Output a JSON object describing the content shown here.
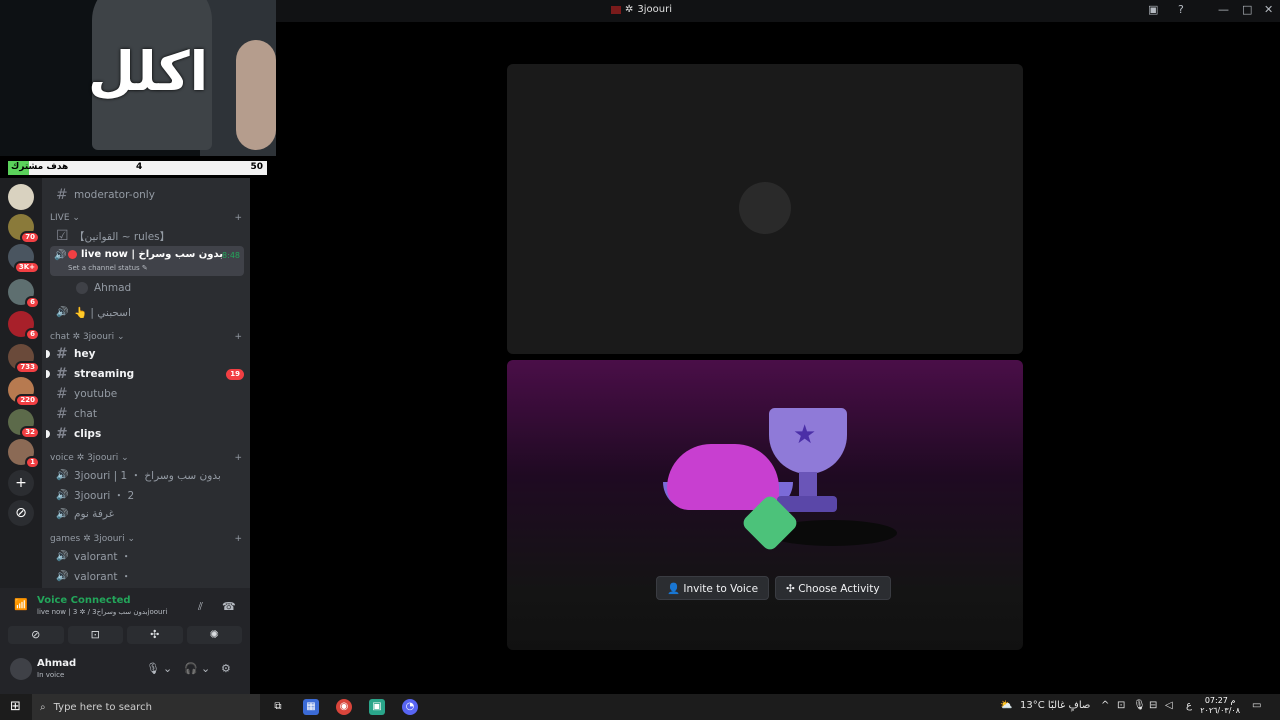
{
  "window": {
    "title": "3joouri",
    "title_prefix": "✲"
  },
  "webcam": {
    "overlay_text": "اكلل"
  },
  "goal": {
    "label": "هدف مشترك",
    "current": "4",
    "target": "50",
    "progress": 0.08
  },
  "servers": [
    {
      "badge": ""
    },
    {
      "badge": "70"
    },
    {
      "badge": "3K+"
    },
    {
      "badge": "6"
    },
    {
      "badge": "6"
    },
    {
      "badge": "733"
    },
    {
      "badge": "220"
    },
    {
      "badge": "32"
    },
    {
      "badge": "1"
    }
  ],
  "server_actions": {
    "add": "+",
    "explore": "⊘"
  },
  "channels": {
    "moderator": "moderator-only",
    "cat_live": "LIVE ⌄",
    "rules": "【القوانين ~ rules】",
    "live_now": {
      "name": "live now | بدون سب وسراخ",
      "status": "Set a channel status ✎",
      "time": "8:48"
    },
    "live_user": "Ahmad",
    "voice_extra": "👆 | اسحبني",
    "cat_chat": "chat ✲ 3joouri ⌄",
    "text": [
      {
        "name": "hey",
        "unread": true,
        "badge": ""
      },
      {
        "name": "streaming",
        "unread": true,
        "badge": "19"
      },
      {
        "name": "youtube",
        "unread": false,
        "badge": ""
      },
      {
        "name": "chat",
        "unread": false,
        "badge": ""
      },
      {
        "name": "clips",
        "unread": true,
        "badge": ""
      }
    ],
    "cat_voice": "voice ✲ 3joouri ⌄",
    "voice": [
      "3joouri | 1 ・ بدون سب وسراخ",
      "3joouri ・ 2",
      "غرفة نوم"
    ],
    "cat_games": "games ✲ 3joouri ⌄",
    "games": [
      "valorant ・",
      "valorant ・"
    ]
  },
  "voice_panel": {
    "title": "Voice Connected",
    "subtitle": "live now | 3 ✲ / بدون سب وسراخ3joouri"
  },
  "user": {
    "name": "Ahmad",
    "status": "In voice"
  },
  "stage": {
    "invite": "Invite to Voice",
    "activity": "Choose Activity"
  },
  "taskbar": {
    "search_placeholder": "Type here to search",
    "weather": "13°C  صافٍ غالبًا",
    "lang": "ع",
    "time": "07:27 م",
    "date": "٢٠٢٦/٠٣/٠٨"
  },
  "colors": {
    "accent_green": "#23a55a",
    "badge_red": "#f23f43",
    "sidebar_bg": "#2b2d31"
  }
}
